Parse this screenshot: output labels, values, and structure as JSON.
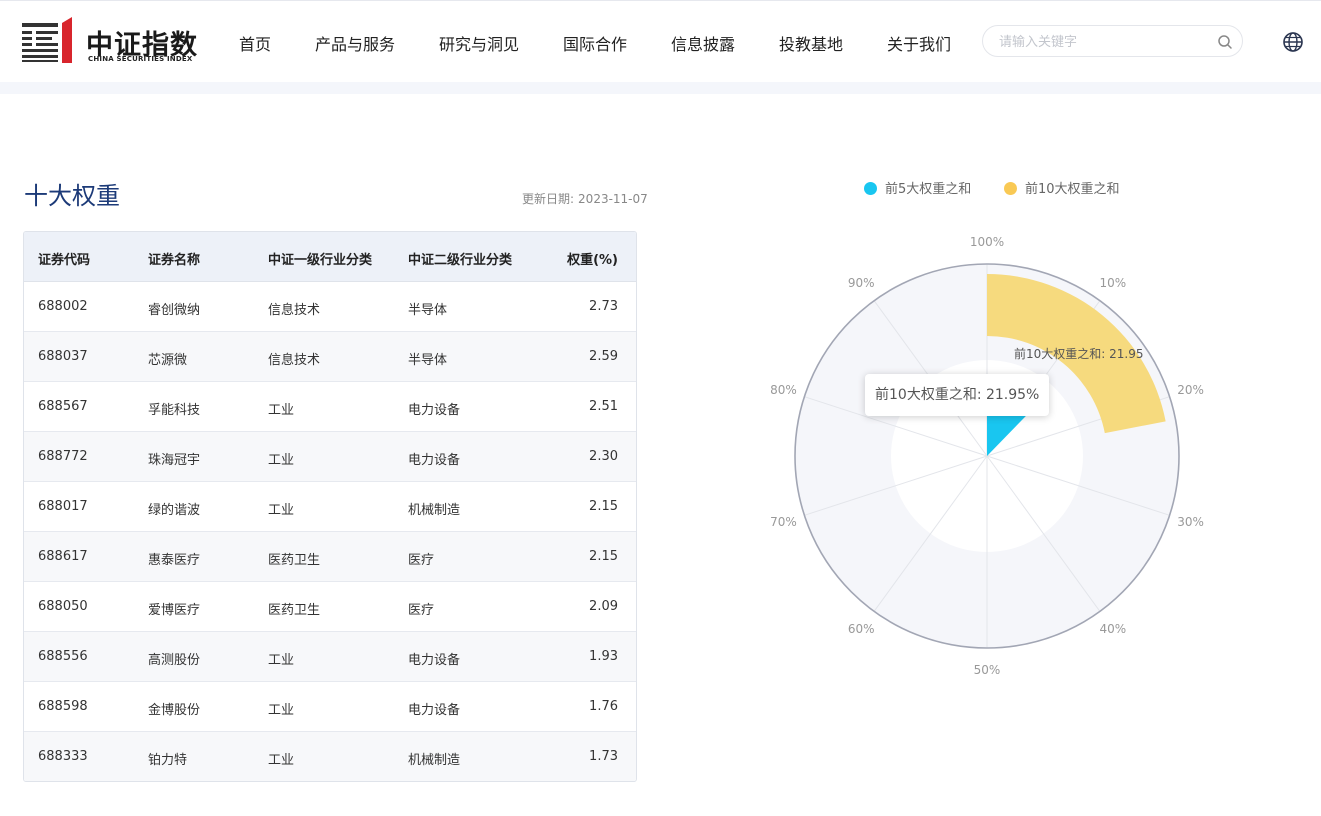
{
  "header": {
    "logo_cn": "中证指数",
    "logo_en": "CHINA SECURITIES INDEX",
    "nav": [
      "首页",
      "产品与服务",
      "研究与洞见",
      "国际合作",
      "信息披露",
      "投教基地",
      "关于我们"
    ],
    "search_placeholder": "请输入关键字"
  },
  "section": {
    "title": "十大权重",
    "update_label": "更新日期:",
    "update_date": "2023-11-07"
  },
  "table": {
    "headers": [
      "证券代码",
      "证券名称",
      "中证一级行业分类",
      "中证二级行业分类",
      "权重(%)"
    ],
    "rows": [
      {
        "code": "688002",
        "name": "睿创微纳",
        "ind1": "信息技术",
        "ind2": "半导体",
        "weight": "2.73"
      },
      {
        "code": "688037",
        "name": "芯源微",
        "ind1": "信息技术",
        "ind2": "半导体",
        "weight": "2.59"
      },
      {
        "code": "688567",
        "name": "孚能科技",
        "ind1": "工业",
        "ind2": "电力设备",
        "weight": "2.51"
      },
      {
        "code": "688772",
        "name": "珠海冠宇",
        "ind1": "工业",
        "ind2": "电力设备",
        "weight": "2.30"
      },
      {
        "code": "688017",
        "name": "绿的谐波",
        "ind1": "工业",
        "ind2": "机械制造",
        "weight": "2.15"
      },
      {
        "code": "688617",
        "name": "惠泰医疗",
        "ind1": "医药卫生",
        "ind2": "医疗",
        "weight": "2.15"
      },
      {
        "code": "688050",
        "name": "爱博医疗",
        "ind1": "医药卫生",
        "ind2": "医疗",
        "weight": "2.09"
      },
      {
        "code": "688556",
        "name": "高测股份",
        "ind1": "工业",
        "ind2": "电力设备",
        "weight": "1.93"
      },
      {
        "code": "688598",
        "name": "金博股份",
        "ind1": "工业",
        "ind2": "电力设备",
        "weight": "1.76"
      },
      {
        "code": "688333",
        "name": "铂力特",
        "ind1": "工业",
        "ind2": "机械制造",
        "weight": "1.73"
      }
    ]
  },
  "chart_data": {
    "type": "polar-bar",
    "angle_ticks": [
      "100%",
      "10%",
      "20%",
      "30%",
      "40%",
      "50%",
      "60%",
      "70%",
      "80%",
      "90%"
    ],
    "series": [
      {
        "name": "前5大权重之和",
        "value": 12.28,
        "color": "#19c6f0"
      },
      {
        "name": "前10大权重之和",
        "value": 21.95,
        "color": "#f6da7e"
      }
    ],
    "data_label": "前10大权重之和: 21.95",
    "tooltip": "前10大权重之和: 21.95%"
  },
  "colors": {
    "title": "#1c3a78",
    "logo_red": "#d8252c"
  }
}
